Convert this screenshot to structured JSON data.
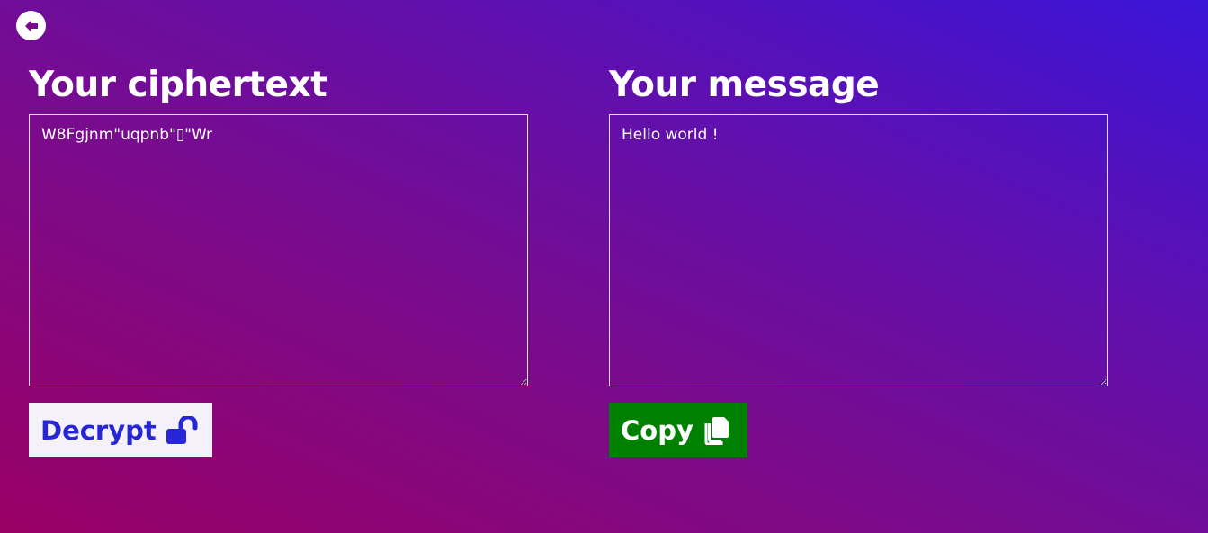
{
  "nav": {
    "back_icon": "arrow-left-circle-icon"
  },
  "ciphertext_panel": {
    "title": "Your ciphertext",
    "value": "W8Fgjnm\"uqpnb\"▯\"Wr",
    "button_label": "Decrypt",
    "button_icon": "unlock-icon"
  },
  "message_panel": {
    "title": "Your message",
    "value": "Hello world !",
    "button_label": "Copy",
    "button_icon": "copy-icon"
  },
  "colors": {
    "background_start": "#9a0065",
    "background_end": "#3a14d8",
    "decrypt_button_bg": "#f4f2f8",
    "decrypt_button_text": "#2626d6",
    "copy_button_bg": "#008000",
    "copy_button_text": "#ffffff"
  }
}
